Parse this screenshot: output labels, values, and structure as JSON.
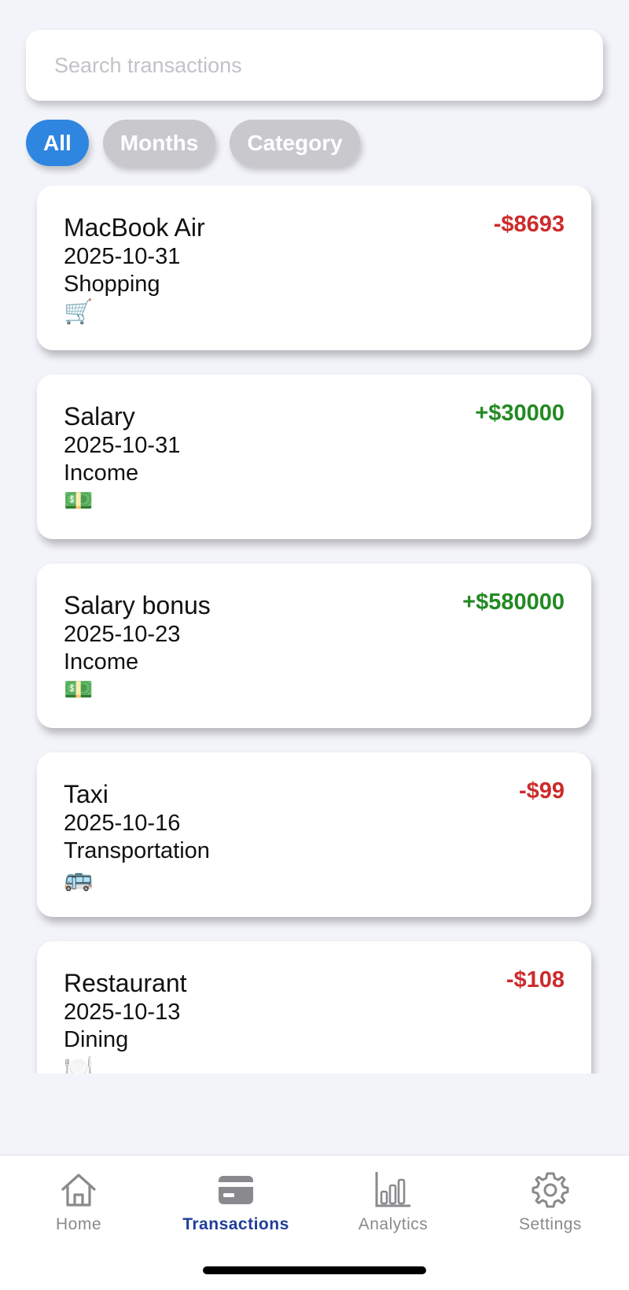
{
  "search": {
    "placeholder": "Search transactions",
    "value": ""
  },
  "filters": [
    {
      "label": "All",
      "active": true
    },
    {
      "label": "Months",
      "active": false
    },
    {
      "label": "Category",
      "active": false
    }
  ],
  "transactions": [
    {
      "name": "MacBook Air",
      "date": "2025-10-31",
      "category": "Shopping",
      "emoji": "🛒",
      "amount": "-$8693",
      "kind": "expense"
    },
    {
      "name": "Salary",
      "date": "2025-10-31",
      "category": "Income",
      "emoji": "💵",
      "amount": "+$30000",
      "kind": "income"
    },
    {
      "name": "Salary bonus",
      "date": "2025-10-23",
      "category": "Income",
      "emoji": "💵",
      "amount": "+$580000",
      "kind": "income"
    },
    {
      "name": "Taxi",
      "date": "2025-10-16",
      "category": "Transportation",
      "emoji": "🚌",
      "amount": "-$99",
      "kind": "expense"
    },
    {
      "name": "Restaurant",
      "date": "2025-10-13",
      "category": "Dining",
      "emoji": "🍽️",
      "amount": "-$108",
      "kind": "expense"
    }
  ],
  "tabs": [
    {
      "label": "Home",
      "icon": "home-icon",
      "active": false
    },
    {
      "label": "Transactions",
      "icon": "card-icon",
      "active": true
    },
    {
      "label": "Analytics",
      "icon": "bar-chart-icon",
      "active": false
    },
    {
      "label": "Settings",
      "icon": "gear-icon",
      "active": false
    }
  ],
  "colors": {
    "accent": "#2f86e0",
    "active_tab": "#1f3d9a",
    "expense": "#cc2b2b",
    "income": "#238a23",
    "background": "#f3f4fa"
  }
}
